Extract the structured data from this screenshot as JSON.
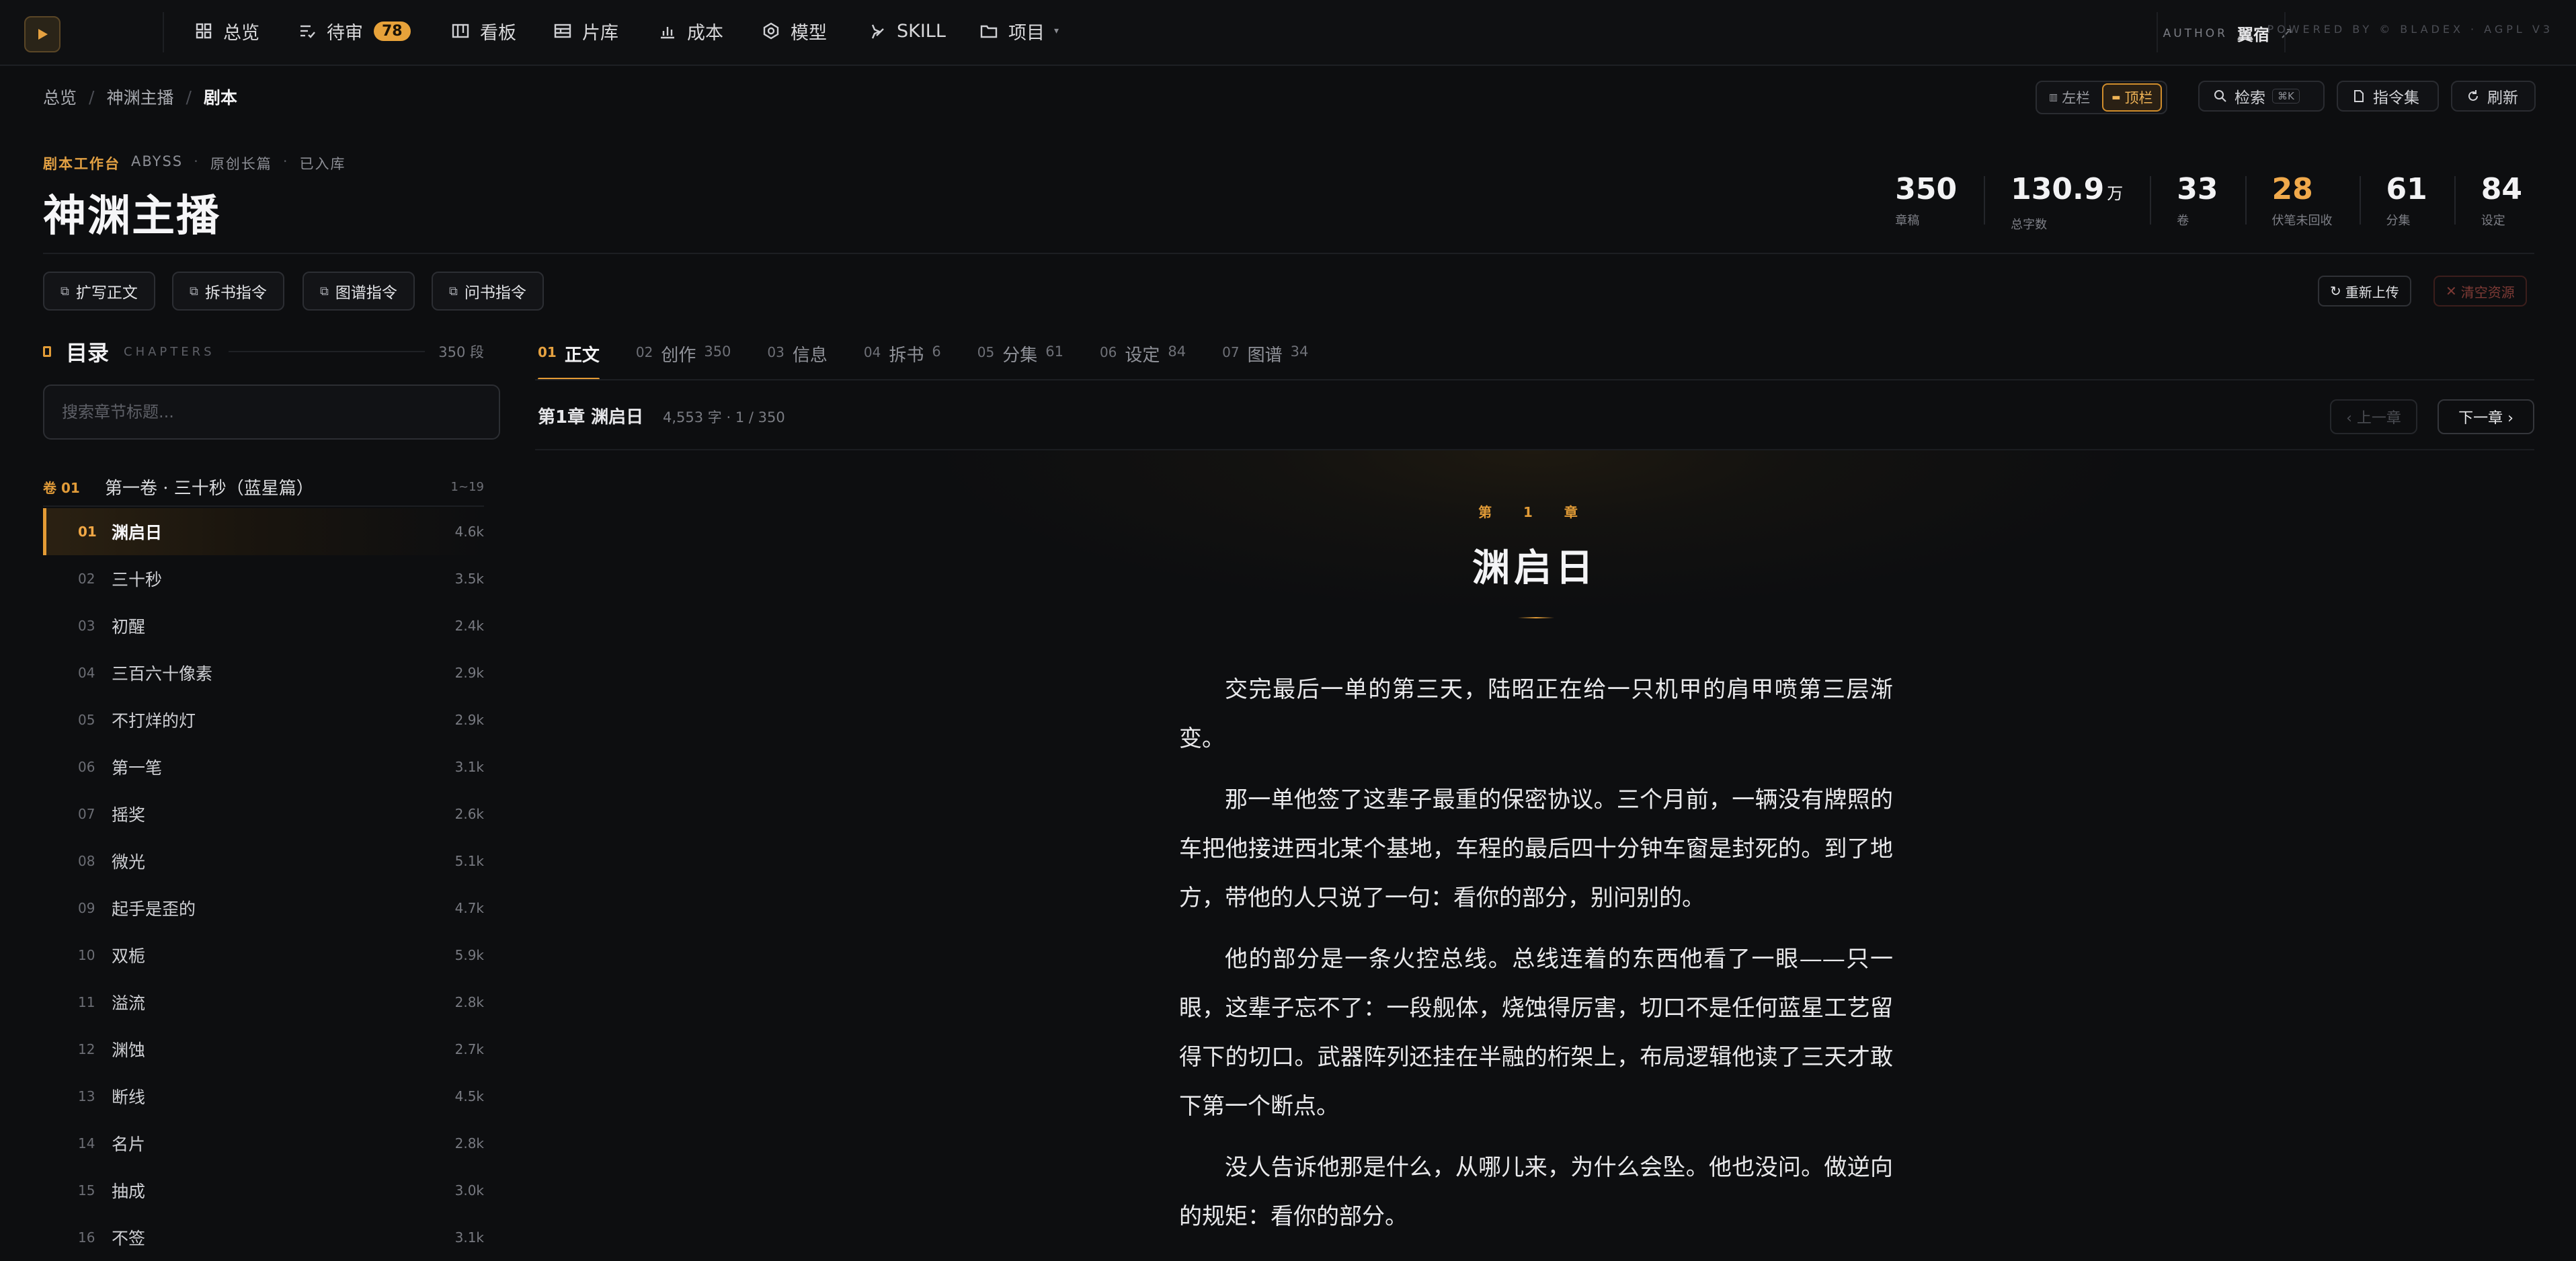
{
  "nav": {
    "items": [
      {
        "label": "总览",
        "icon": "grid-icon"
      },
      {
        "label": "待审",
        "icon": "list-check-icon",
        "badge": "78"
      },
      {
        "label": "看板",
        "icon": "kanban-icon"
      },
      {
        "label": "片库",
        "icon": "film-icon"
      },
      {
        "label": "成本",
        "icon": "bar-chart-icon"
      },
      {
        "label": "模型",
        "icon": "hexagon-icon"
      },
      {
        "label": "SKILL",
        "icon": "sparkle-icon"
      },
      {
        "label": "项目",
        "icon": "folder-icon"
      }
    ],
    "author_label": "AUTHOR",
    "author_name": "翼宿",
    "powered_by": "POWERED BY © BLADEX · AGPL V3"
  },
  "breadcrumb": [
    "总览",
    "神渊主播",
    "剧本"
  ],
  "toolbar": {
    "layout_left": "左栏",
    "layout_top": "顶栏",
    "search_label": "检索",
    "search_kbd": "⌘K",
    "commands_label": "指令集",
    "refresh_label": "刷新"
  },
  "header": {
    "kicker": "剧本工作台",
    "meta1": "ABYSS",
    "meta2": "原创长篇",
    "meta3": "已入库",
    "title": "神渊主播"
  },
  "stats": [
    {
      "value": "350",
      "unit": "",
      "label": "章稿"
    },
    {
      "value": "130.9",
      "unit": "万",
      "label": "总字数"
    },
    {
      "value": "33",
      "unit": "",
      "label": "卷"
    },
    {
      "value": "28",
      "unit": "",
      "label": "伏笔未回收"
    },
    {
      "value": "61",
      "unit": "",
      "label": "分集"
    },
    {
      "value": "84",
      "unit": "",
      "label": "设定"
    }
  ],
  "actions": {
    "expand": "扩写正文",
    "split": "拆书指令",
    "graph": "图谱指令",
    "ask": "问书指令",
    "reupload": "重新上传",
    "clear": "清空资源"
  },
  "toc": {
    "title": "目录",
    "subtitle": "CHAPTERS",
    "count": "350 段",
    "search_placeholder": "搜索章节标题...",
    "volume": {
      "num": "卷 01",
      "title": "第一卷 · 三十秒（蓝星篇）",
      "range": "1~19"
    },
    "chapters": [
      {
        "num": "01",
        "title": "渊启日",
        "size": "4.6k"
      },
      {
        "num": "02",
        "title": "三十秒",
        "size": "3.5k"
      },
      {
        "num": "03",
        "title": "初醒",
        "size": "2.4k"
      },
      {
        "num": "04",
        "title": "三百六十像素",
        "size": "2.9k"
      },
      {
        "num": "05",
        "title": "不打烊的灯",
        "size": "2.9k"
      },
      {
        "num": "06",
        "title": "第一笔",
        "size": "3.1k"
      },
      {
        "num": "07",
        "title": "摇奖",
        "size": "2.6k"
      },
      {
        "num": "08",
        "title": "微光",
        "size": "5.1k"
      },
      {
        "num": "09",
        "title": "起手是歪的",
        "size": "4.7k"
      },
      {
        "num": "10",
        "title": "双栀",
        "size": "5.9k"
      },
      {
        "num": "11",
        "title": "溢流",
        "size": "2.8k"
      },
      {
        "num": "12",
        "title": "渊蚀",
        "size": "2.7k"
      },
      {
        "num": "13",
        "title": "断线",
        "size": "4.5k"
      },
      {
        "num": "14",
        "title": "名片",
        "size": "2.8k"
      },
      {
        "num": "15",
        "title": "抽成",
        "size": "3.0k"
      },
      {
        "num": "16",
        "title": "不签",
        "size": "3.1k"
      }
    ]
  },
  "tabs": [
    {
      "num": "01",
      "label": "正文",
      "count": ""
    },
    {
      "num": "02",
      "label": "创作",
      "count": "350"
    },
    {
      "num": "03",
      "label": "信息",
      "count": ""
    },
    {
      "num": "04",
      "label": "拆书",
      "count": "6"
    },
    {
      "num": "05",
      "label": "分集",
      "count": "61"
    },
    {
      "num": "06",
      "label": "设定",
      "count": "84"
    },
    {
      "num": "07",
      "label": "图谱",
      "count": "34"
    }
  ],
  "chapter_bar": {
    "title": "第1章 渊启日",
    "meta": "4,553 字 · 1 / 350",
    "prev": "‹ 上一章",
    "next": "下一章 ›"
  },
  "reader": {
    "kicker": "第 1 章",
    "title": "渊启日",
    "paragraphs": [
      "交完最后一单的第三天，陆昭正在给一只机甲的肩甲喷第三层渐变。",
      "那一单他签了这辈子最重的保密协议。三个月前，一辆没有牌照的车把他接进西北某个基地，车程的最后四十分钟车窗是封死的。到了地方，带他的人只说了一句：看你的部分，别问别的。",
      "他的部分是一条火控总线。总线连着的东西他看了一眼——只一眼，这辈子忘不了：一段舰体，烧蚀得厉害，切口不是任何蓝星工艺留得下的切口。武器阵列还挂在半融的桁架上，布局逻辑他读了三天才敢下第一个断点。",
      "没人告诉他那是什么，从哪儿来，为什么会坠。他也没问。做逆向的规矩：看你的部分。"
    ]
  },
  "colors": {
    "accent": "#e39b35",
    "background": "#0d0e10",
    "danger": "#7d3a35"
  }
}
